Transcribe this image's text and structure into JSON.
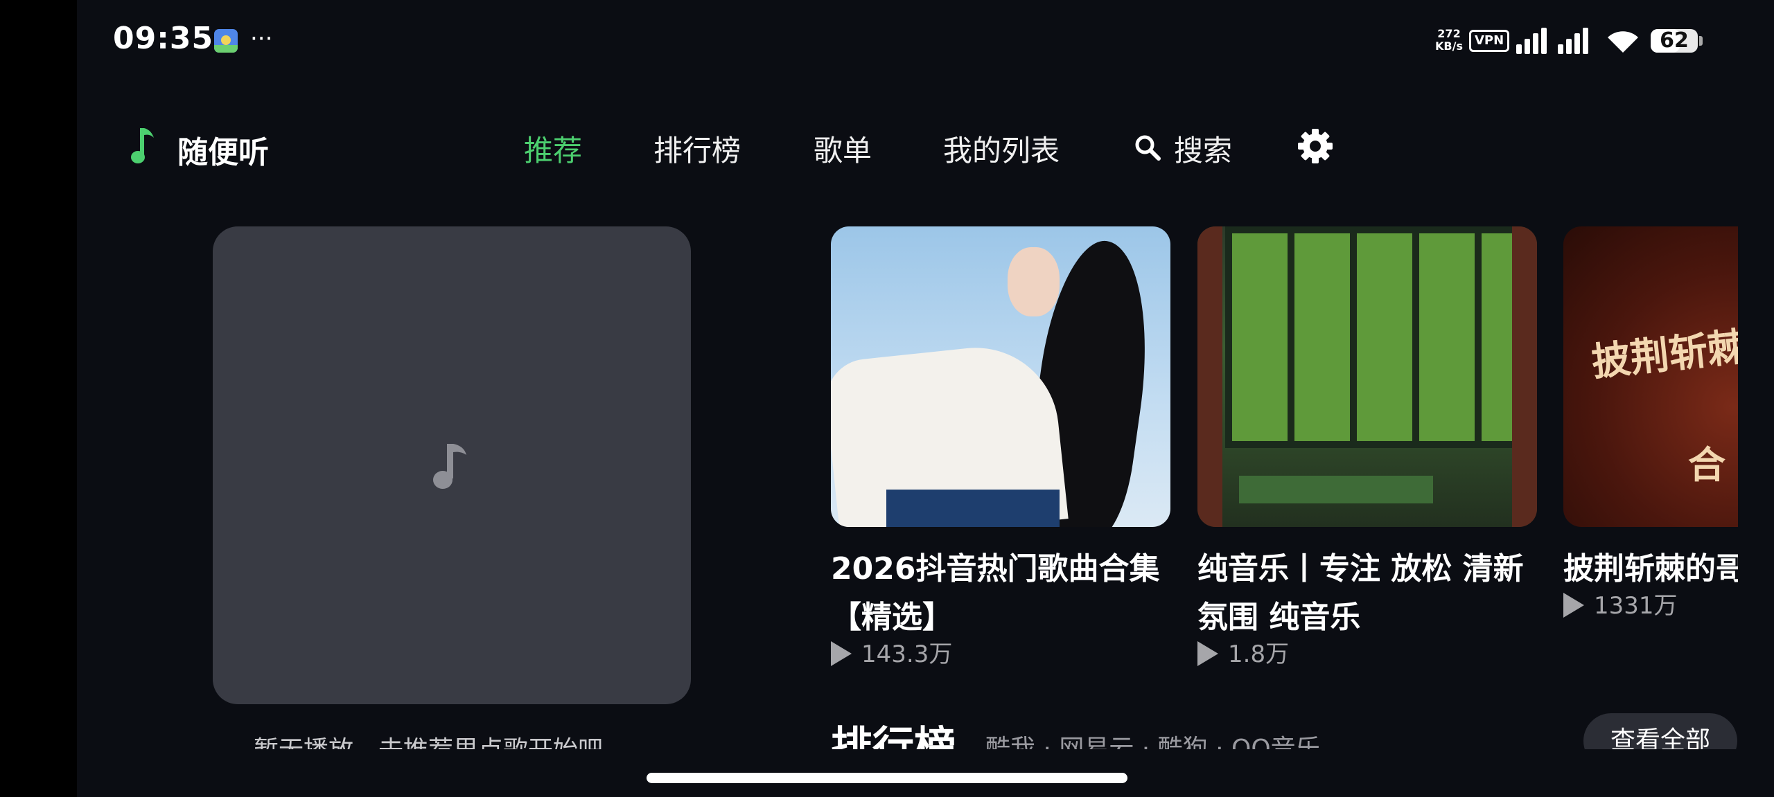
{
  "status_bar": {
    "time": "09:35",
    "more": "···",
    "net_speed_value": "272",
    "net_speed_unit": "KB/s",
    "vpn": "VPN",
    "battery": "62",
    "battery_level": 0.62
  },
  "header": {
    "app_name": "随便听",
    "nav": {
      "recommend": "推荐",
      "charts": "排行榜",
      "playlists": "歌单",
      "my_list": "我的列表",
      "search": "搜索"
    },
    "accent_color": "#4ccf6f"
  },
  "now_playing": {
    "hint": "暂无播放，去推荐里点歌开始吧"
  },
  "playlists": [
    {
      "title": "2026抖音热门歌曲合集【精选】",
      "plays": "143.3万"
    },
    {
      "title": "纯音乐丨专注 放松 清新 氛围 纯音乐",
      "plays": "1.8万"
    },
    {
      "title": "披荆斩棘的哥哥",
      "plays": "1331万",
      "cover_text": "披荆斩棘",
      "cover_text2": "合"
    }
  ],
  "rankings": {
    "title": "排行榜",
    "sources": "酷我 · 网易云 · 酷狗 · QQ音乐",
    "view_all": "查看全部"
  },
  "icons": {
    "logo": "music-note-icon",
    "search": "search-icon",
    "settings": "gear-icon",
    "placeholder": "music-note-icon",
    "play": "play-icon"
  }
}
